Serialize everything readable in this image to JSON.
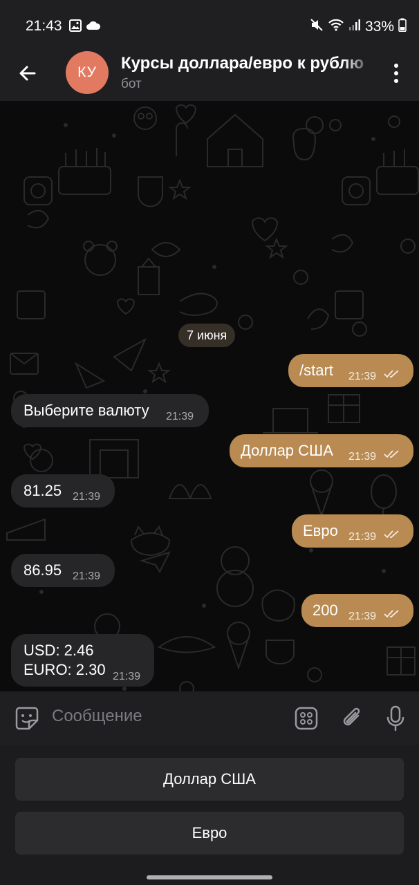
{
  "status_bar": {
    "time": "21:43",
    "battery": "33%",
    "icons": [
      "image-icon",
      "cloud-icon",
      "mute-icon",
      "wifi-icon",
      "signal-icon",
      "battery-icon"
    ]
  },
  "header": {
    "avatar_initials": "КУ",
    "title": "Курсы доллара/евро к рублю",
    "subtitle": "бот"
  },
  "chat": {
    "date_chip": "7 июня",
    "messages": [
      {
        "dir": "out",
        "text": "/start",
        "time": "21:39"
      },
      {
        "dir": "in",
        "text": "Выберите валюту",
        "time": "21:39"
      },
      {
        "dir": "out",
        "text": "Доллар США",
        "time": "21:39"
      },
      {
        "dir": "in",
        "text": "81.25",
        "time": "21:39"
      },
      {
        "dir": "out",
        "text": "Евро",
        "time": "21:39"
      },
      {
        "dir": "in",
        "text": "86.95",
        "time": "21:39"
      },
      {
        "dir": "out",
        "text": "200",
        "time": "21:39"
      },
      {
        "dir": "in",
        "text_line1": "USD: 2.46",
        "text_line2": "EURO: 2.30",
        "time": "21:39"
      }
    ]
  },
  "composer": {
    "placeholder": "Сообщение"
  },
  "keyboard": {
    "buttons": [
      "Доллар США",
      "Евро"
    ]
  },
  "colors": {
    "out_bubble": "#b98a52",
    "in_bubble": "#262628",
    "avatar": "#e27a62"
  }
}
